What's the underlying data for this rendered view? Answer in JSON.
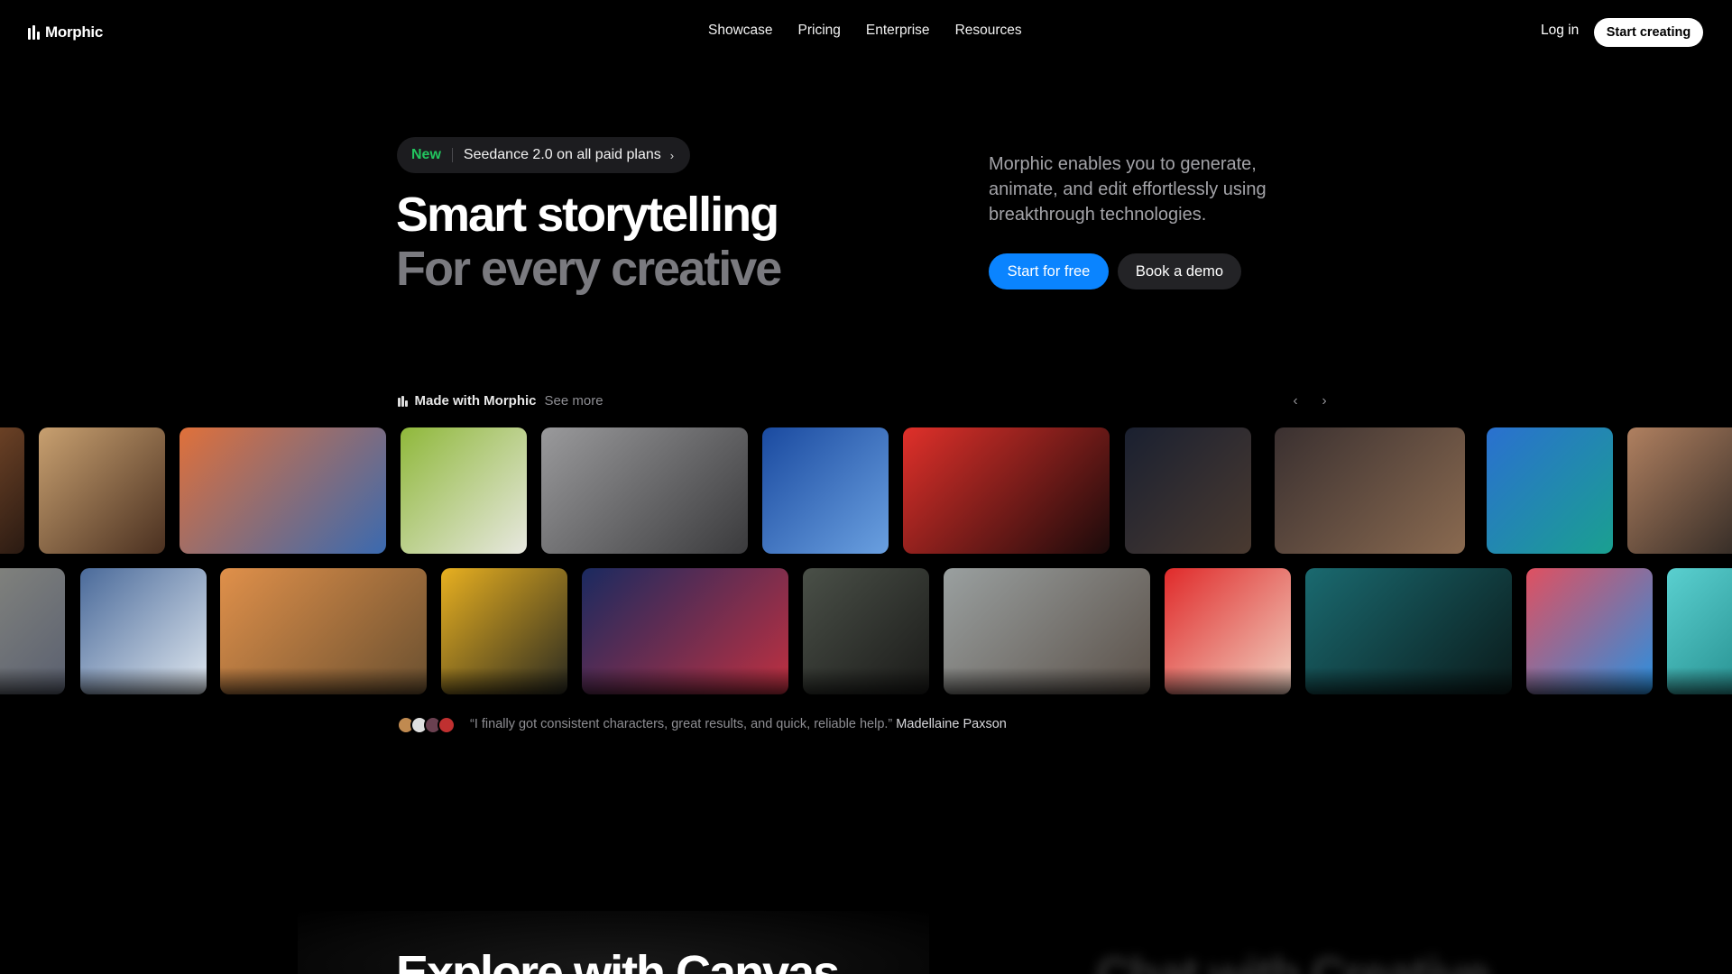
{
  "nav": {
    "logo_text": "Morphic",
    "links": [
      "Showcase",
      "Pricing",
      "Enterprise",
      "Resources"
    ],
    "login": "Log in",
    "cta": "Start creating"
  },
  "hero": {
    "badge_new": "New",
    "badge_text": "Seedance 2.0 on all paid plans",
    "title_line1": "Smart storytelling",
    "title_line2": "For every creative",
    "description": "Morphic enables you to generate, animate, and edit effortlessly using breakthrough technologies.",
    "primary_button": "Start for free",
    "secondary_button": "Book a demo"
  },
  "gallery": {
    "title": "Made with Morphic",
    "see_more": "See more",
    "row1": [
      {
        "name": "rooftop-edge",
        "colors": [
          "#7a4a2a",
          "#2a1a12"
        ]
      },
      {
        "name": "factory-smoke",
        "colors": [
          "#c8a070",
          "#4a3020"
        ]
      },
      {
        "name": "rock-climber",
        "colors": [
          "#e0703a",
          "#3a6ab0"
        ]
      },
      {
        "name": "woman-green-sofa",
        "colors": [
          "#8fb83a",
          "#e8e8e0"
        ]
      },
      {
        "name": "storm-street",
        "colors": [
          "#9a9a9c",
          "#3a3a3c"
        ]
      },
      {
        "name": "blue-illustration-girl",
        "colors": [
          "#1a4aa0",
          "#6aa0e0"
        ]
      },
      {
        "name": "black-panther-red",
        "colors": [
          "#e0302a",
          "#1a0a0a"
        ]
      },
      {
        "name": "man-night-city",
        "colors": [
          "#1a2030",
          "#4a3a30"
        ]
      },
      {
        "name": "paris-fireworks",
        "colors": [
          "#3a3030",
          "#8a6a50"
        ]
      },
      {
        "name": "saxophone-player",
        "colors": [
          "#2a70d0",
          "#1aa090"
        ]
      },
      {
        "name": "man-closeup",
        "colors": [
          "#b08060",
          "#1a1a1a"
        ]
      }
    ],
    "row2": [
      {
        "name": "old-buildings",
        "colors": [
          "#8a8a80",
          "#5a6070"
        ]
      },
      {
        "name": "parkour-jump",
        "colors": [
          "#4a6a9a",
          "#e0e8f0"
        ]
      },
      {
        "name": "explosion-field",
        "colors": [
          "#e0904a",
          "#6a5030"
        ]
      },
      {
        "name": "yellow-corridor-woman",
        "colors": [
          "#e8b020",
          "#2a2a20"
        ]
      },
      {
        "name": "woman-blue-gun",
        "colors": [
          "#1a2a60",
          "#c03040"
        ]
      },
      {
        "name": "kitchen-cabinets",
        "colors": [
          "#4a5048",
          "#1a1a18"
        ]
      },
      {
        "name": "ferris-wheel-soldier",
        "colors": [
          "#9aa0a0",
          "#5a5048"
        ]
      },
      {
        "name": "woman-red-studio",
        "colors": [
          "#e02a2a",
          "#f0d0c0"
        ]
      },
      {
        "name": "teal-particles",
        "colors": [
          "#1a6a70",
          "#0a1a1a"
        ]
      },
      {
        "name": "blue-liquid-face",
        "colors": [
          "#e05060",
          "#2a90e0"
        ]
      },
      {
        "name": "ocean-horizon",
        "colors": [
          "#5ad0d0",
          "#1a8080"
        ]
      }
    ]
  },
  "testimonial": {
    "quote": "“I finally got consistent characters, great results, and quick, reliable help.”",
    "author": "Madellaine Paxson",
    "avatar_colors": [
      "#c08a50",
      "#e0e0e0",
      "#6a4050",
      "#c03030"
    ]
  },
  "section2": {
    "title": "Explore with Canvas",
    "blurred_title": "Chat with Creative"
  },
  "colors": {
    "accent": "#0a84ff",
    "badge_green": "#22c55e"
  },
  "icons": {
    "pill_chevron": "chevron-right-icon",
    "prev": "chevron-left-icon",
    "next": "chevron-right-icon"
  }
}
